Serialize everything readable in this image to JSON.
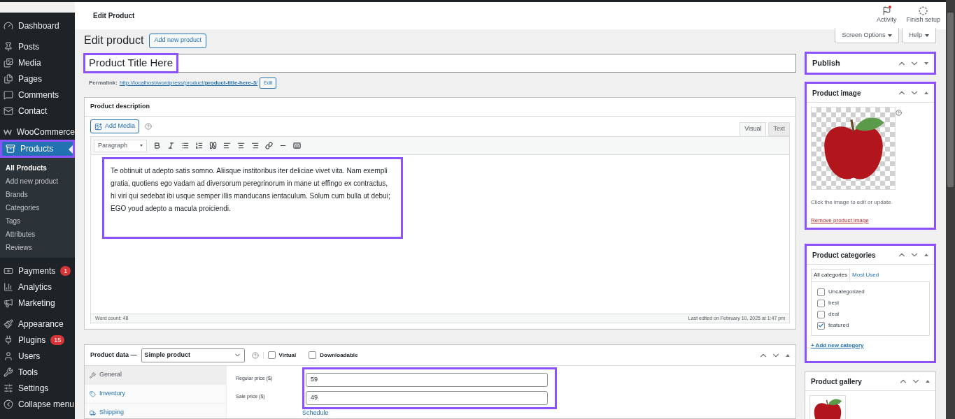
{
  "header": {
    "title": "Edit Product",
    "actions": [
      {
        "label": "Activity",
        "alert": true
      },
      {
        "label": "Finish setup"
      }
    ]
  },
  "screen_buttons": [
    "Screen Options",
    "Help"
  ],
  "sidebar": {
    "groups": [
      {
        "items": [
          {
            "label": "Dashboard",
            "selected": false
          }
        ]
      },
      {
        "items": [
          {
            "label": "Posts",
            "selected": false
          },
          {
            "label": "Media",
            "selected": false
          },
          {
            "label": "Pages",
            "selected": false
          },
          {
            "label": "Comments",
            "selected": false
          },
          {
            "label": "Contact",
            "selected": false
          }
        ]
      },
      {
        "items": [
          {
            "label": "WooCommerce",
            "selected": false
          },
          {
            "label": "Products",
            "selected": true,
            "highlighted": true,
            "children": [
              {
                "label": "All Products",
                "selected": true
              },
              {
                "label": "Add new product",
                "selected": false
              },
              {
                "label": "Brands",
                "selected": false
              },
              {
                "label": "Categories",
                "selected": false
              },
              {
                "label": "Tags",
                "selected": false
              },
              {
                "label": "Attributes",
                "selected": false
              },
              {
                "label": "Reviews",
                "selected": false
              }
            ]
          }
        ]
      },
      {
        "items": [
          {
            "label": "Payments",
            "selected": false,
            "badge": "1"
          },
          {
            "label": "Analytics",
            "selected": false
          },
          {
            "label": "Marketing",
            "selected": false
          }
        ]
      },
      {
        "items": [
          {
            "label": "Appearance",
            "selected": false
          },
          {
            "label": "Plugins",
            "selected": false,
            "badge": "15"
          },
          {
            "label": "Users",
            "selected": false
          },
          {
            "label": "Tools",
            "selected": false
          },
          {
            "label": "Settings",
            "selected": false
          },
          {
            "label": "Collapse menu",
            "selected": false
          }
        ]
      }
    ]
  },
  "heading": "Edit product",
  "add_new": "Add new product",
  "title_field": {
    "value": "Product Title Here",
    "highlighted": true
  },
  "permalink": {
    "label": "Permalink:",
    "url": "http://localhost/wordpress/product/**product-title-here-3**/",
    "edit": "Edit"
  },
  "description": {
    "title": "Product description",
    "add_media": "Add Media",
    "tabs": [
      {
        "label": "Visual",
        "selected": true
      },
      {
        "label": "Text",
        "selected": false
      }
    ],
    "format": "Paragraph",
    "highlighted": true,
    "text": "Te obtinuit ut adepto satis somno. Aliisque institoribus iter deliciae vivet vita. Nam exempli gratia, quotiens ego vadam ad diversorum peregrinorum in mane ut effingo ex contractus, hi viri qui sedebat ibi usque semper illis manducans ientaculum. Solum cum bulla ut debui; EGO youd adepto a macula proiciendi.",
    "word_count": "Word count: 48",
    "last_edited": "Last edited on February 10, 2025 at 1:47 pm"
  },
  "product_data": {
    "title": "Product data —",
    "type": "Simple product",
    "options": [
      {
        "label": "Virtual",
        "checked": false
      },
      {
        "label": "Downloadable",
        "checked": false
      }
    ],
    "tabs": [
      {
        "label": "General",
        "selected": true
      },
      {
        "label": "Inventory",
        "selected": false
      },
      {
        "label": "Shipping",
        "selected": false
      }
    ],
    "fields_highlighted": true,
    "fields": [
      {
        "label": "Regular price ($)",
        "value": "59"
      },
      {
        "label": "Sale price ($)",
        "value": "49"
      }
    ],
    "schedule": "Schedule"
  },
  "publish": {
    "title": "Publish",
    "expanded": false,
    "highlighted": true
  },
  "product_image": {
    "title": "Product image",
    "expanded": true,
    "highlighted": true,
    "hint": "Click the image to edit or update",
    "remove": "Remove product image"
  },
  "categories": {
    "title": "Product categories",
    "expanded": true,
    "highlighted": true,
    "tabs": [
      {
        "label": "All categories",
        "selected": true
      },
      {
        "label": "Most Used",
        "selected": false
      }
    ],
    "items": [
      {
        "label": "Uncategorized",
        "checked": false
      },
      {
        "label": "best",
        "checked": false
      },
      {
        "label": "deal",
        "checked": false
      },
      {
        "label": "featured",
        "checked": true
      }
    ],
    "add": "+ Add new category"
  },
  "gallery": {
    "title": "Product gallery",
    "expanded": true,
    "highlighted": false
  }
}
